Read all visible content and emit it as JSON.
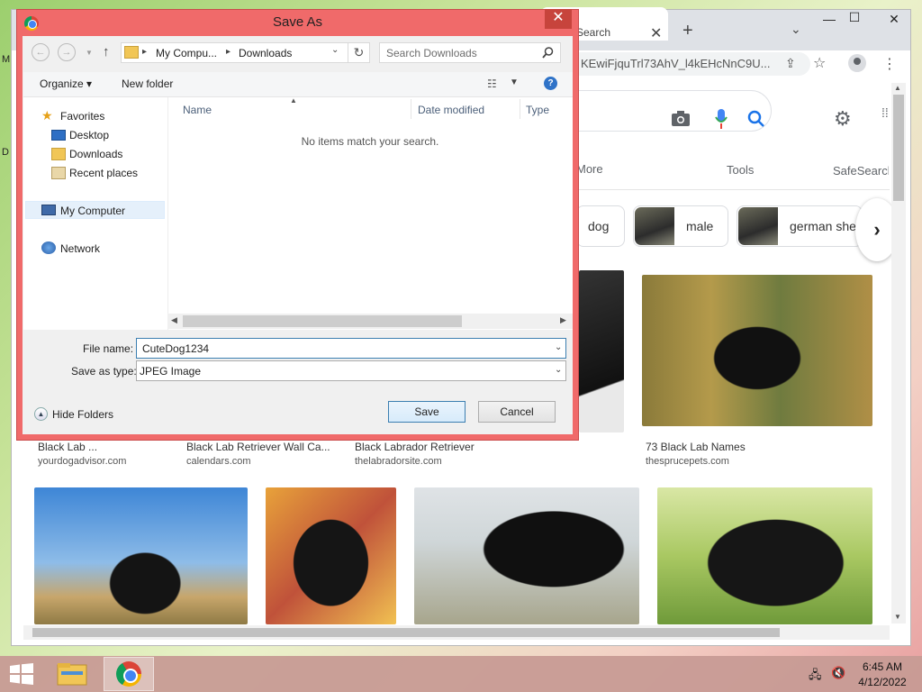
{
  "desktop": {
    "edge_letters": [
      "M",
      "D"
    ]
  },
  "chrome": {
    "tab_title": "Search",
    "tab_close": "✕",
    "new_tab": "+",
    "tab_search": "⌄",
    "url": "KEwiFjquTrl73AhV_l4kEHcNnC9U...",
    "window_controls": [
      "—",
      "☐",
      "✕"
    ]
  },
  "google": {
    "nav": {
      "more": "More",
      "tools": "Tools",
      "safesearch": "SafeSearch"
    },
    "chips": [
      {
        "label": "dog"
      },
      {
        "label": "male"
      },
      {
        "label": "german she"
      }
    ],
    "results_row1": [
      {
        "caption": "Black Lab ...",
        "source": "yourdogadvisor.com"
      },
      {
        "caption": "Black Lab Retriever Wall Ca...",
        "source": "calendars.com"
      },
      {
        "caption": "Black Labrador Retriever",
        "source": "thelabradorsite.com"
      },
      {
        "caption": "73 Black Lab Names",
        "source": "thesprucepets.com"
      }
    ]
  },
  "dialog": {
    "title": "Save As",
    "close": "✕",
    "address": {
      "crumb1": "My Compu...",
      "crumb2": "Downloads"
    },
    "search_placeholder": "Search Downloads",
    "organize": "Organize ▾",
    "new_folder": "New folder",
    "help": "?",
    "nav_tree": {
      "favorites": "Favorites",
      "desktop": "Desktop",
      "downloads": "Downloads",
      "recent": "Recent places",
      "computer": "My Computer",
      "network": "Network"
    },
    "columns": {
      "name": "Name",
      "date": "Date modified",
      "type": "Type"
    },
    "empty_message": "No items match your search.",
    "file_name_label": "File name:",
    "file_name_value": "CuteDog1234",
    "save_type_label": "Save as type:",
    "save_type_value": "JPEG Image",
    "hide_folders": "Hide Folders",
    "save_button": "Save",
    "cancel_button": "Cancel"
  },
  "taskbar": {
    "time": "6:45 AM",
    "date": "4/12/2022"
  }
}
